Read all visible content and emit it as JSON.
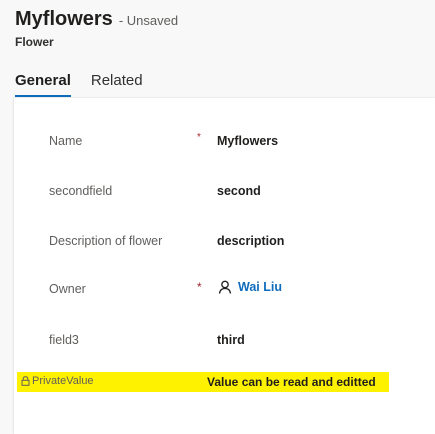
{
  "header": {
    "title": "Myflowers",
    "status": "- Unsaved",
    "entity_type": "Flower"
  },
  "tabs": [
    {
      "label": "General",
      "active": true
    },
    {
      "label": "Related",
      "active": false
    }
  ],
  "fields": [
    {
      "label": "Name",
      "required": "*",
      "value": "Myflowers"
    },
    {
      "label": "secondfield",
      "required": "",
      "value": "second"
    },
    {
      "label": "Description of flower",
      "required": "",
      "value": "description"
    },
    {
      "label": "Owner",
      "required": "*",
      "value": "Wai Liu",
      "icon": "person-icon"
    },
    {
      "label": "field3",
      "required": "",
      "value": "third"
    }
  ],
  "highlighted_field": {
    "icon": "lock-icon",
    "label": "PrivateValue",
    "value": "Value can be read and editted",
    "highlight_color": "#fff200"
  },
  "colors": {
    "accent": "#0f6cbd",
    "required": "#a4262c"
  }
}
